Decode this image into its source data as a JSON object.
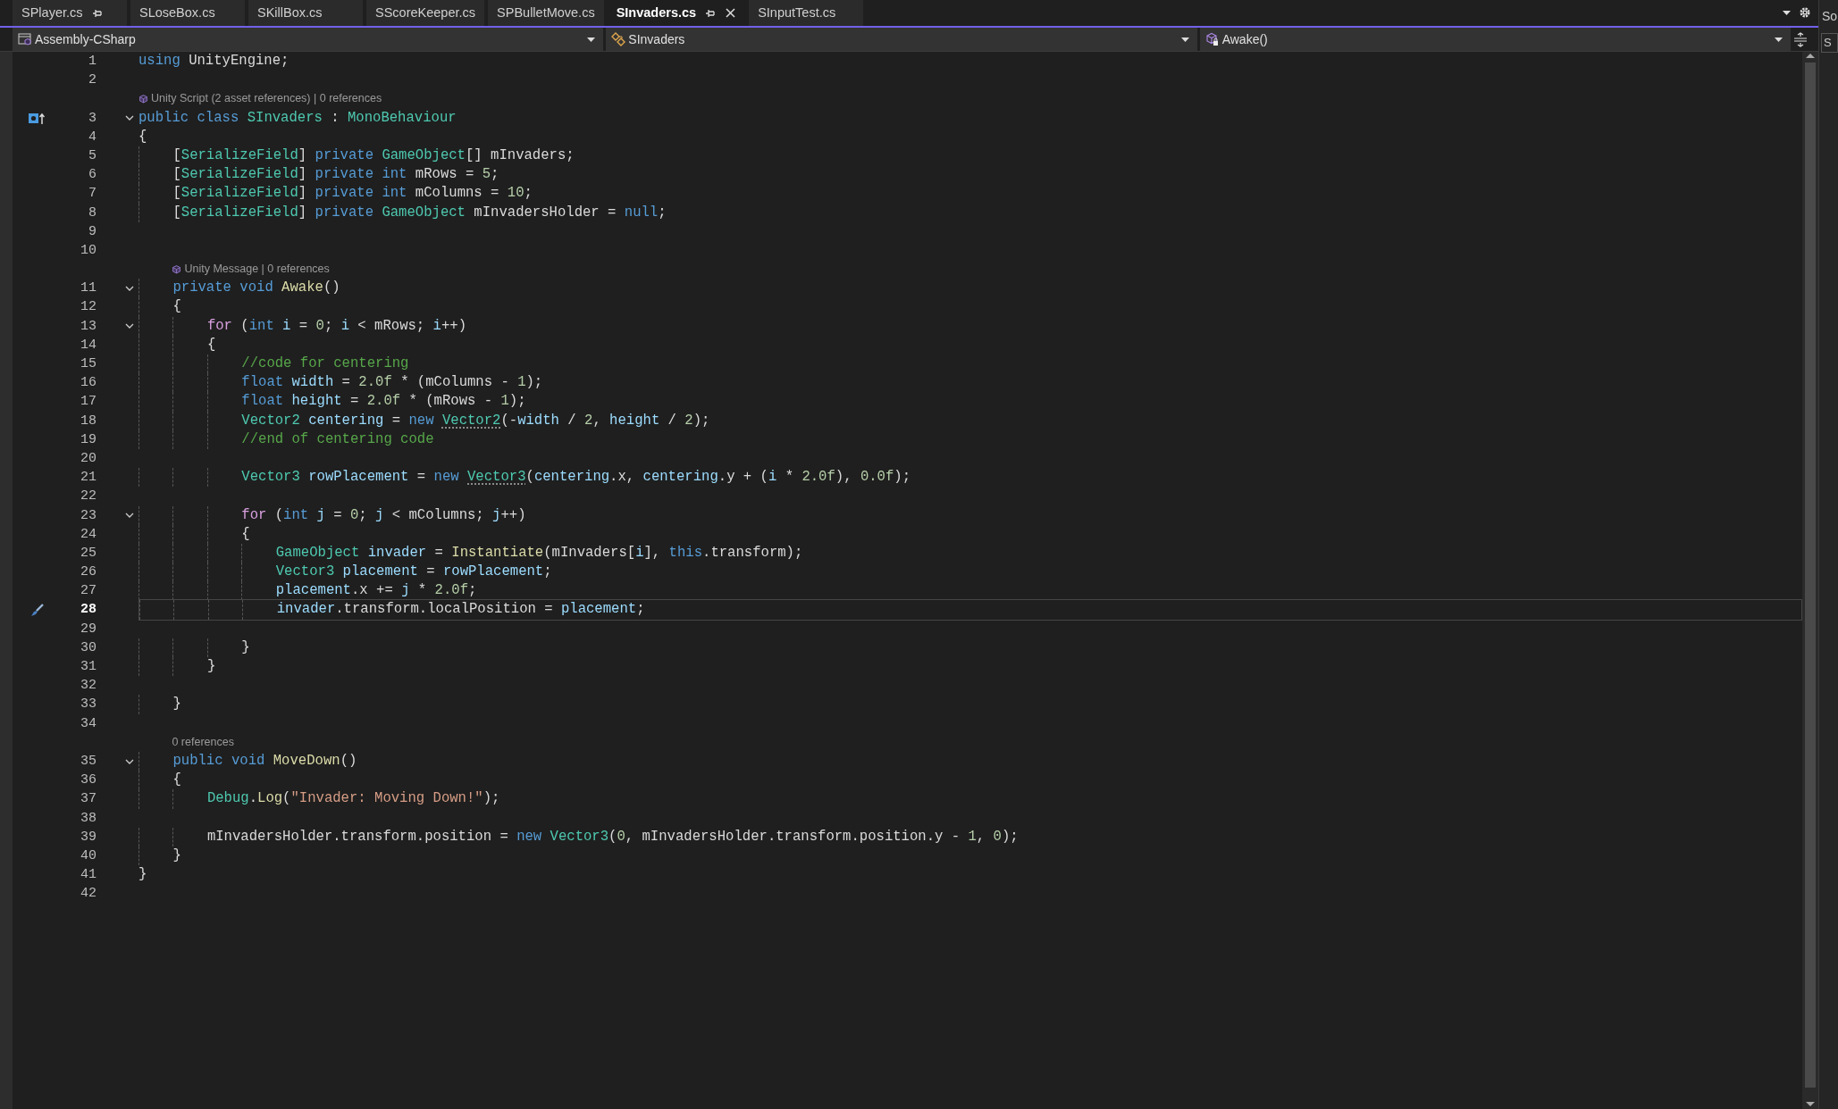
{
  "tabs": [
    {
      "label": "SPlayer.cs",
      "selected": false,
      "pinned": true
    },
    {
      "label": "SLoseBox.cs",
      "selected": false,
      "pinned": false
    },
    {
      "label": "SKillBox.cs",
      "selected": false,
      "pinned": false
    },
    {
      "label": "SScoreKeeper.cs",
      "selected": false,
      "pinned": false
    },
    {
      "label": "SPBulletMove.cs",
      "selected": false,
      "pinned": false
    },
    {
      "label": "SInvaders.cs",
      "selected": true,
      "pinned": true
    },
    {
      "label": "SInputTest.cs",
      "selected": false,
      "pinned": false
    }
  ],
  "navigation_bar": [
    {
      "label": "Assembly-CSharp",
      "kind": "project"
    },
    {
      "label": "SInvaders",
      "kind": "class"
    },
    {
      "label": "Awake()",
      "kind": "method"
    }
  ],
  "lines": [
    {
      "number": "1",
      "current": false,
      "tokens": [
        {
          "kind": "keyword",
          "text": "using"
        },
        {
          "kind": "plain",
          "text": " UnityEngine;"
        }
      ]
    },
    {
      "number": "2",
      "current": false
    },
    {
      "number": "3",
      "current": false,
      "gutter_icon": {
        "kind": "class-marker"
      },
      "expanded": true,
      "codelens": {
        "kind": "unity",
        "text": "Unity Script (2 asset references) | 0 references"
      },
      "tokens": [
        {
          "kind": "keyword",
          "text": "public"
        },
        {
          "kind": "keyword",
          "text": " class"
        },
        {
          "kind": "type",
          "text": " SInvaders"
        },
        {
          "kind": "plain",
          "text": " : "
        },
        {
          "kind": "type",
          "text": "MonoBehaviour"
        }
      ]
    },
    {
      "number": "4",
      "current": false,
      "tokens": [
        {
          "kind": "plain",
          "text": "{"
        }
      ]
    },
    {
      "number": "5",
      "current": false,
      "tokens": [
        {
          "kind": "plain",
          "text": "    ["
        },
        {
          "kind": "type",
          "text": "SerializeField"
        },
        {
          "kind": "plain",
          "text": "] "
        },
        {
          "kind": "keyword",
          "text": "private"
        },
        {
          "kind": "type",
          "text": " GameObject"
        },
        {
          "kind": "plain",
          "text": "[] mInvaders;"
        }
      ]
    },
    {
      "number": "6",
      "current": false,
      "tokens": [
        {
          "kind": "plain",
          "text": "    ["
        },
        {
          "kind": "type",
          "text": "SerializeField"
        },
        {
          "kind": "plain",
          "text": "] "
        },
        {
          "kind": "keyword",
          "text": "private"
        },
        {
          "kind": "keyword",
          "text": " int"
        },
        {
          "kind": "plain",
          "text": " mRows = "
        },
        {
          "kind": "number",
          "text": "5"
        },
        {
          "kind": "plain",
          "text": ";"
        }
      ]
    },
    {
      "number": "7",
      "current": false,
      "tokens": [
        {
          "kind": "plain",
          "text": "    ["
        },
        {
          "kind": "type",
          "text": "SerializeField"
        },
        {
          "kind": "plain",
          "text": "] "
        },
        {
          "kind": "keyword",
          "text": "private"
        },
        {
          "kind": "keyword",
          "text": " int"
        },
        {
          "kind": "plain",
          "text": " mColumns = "
        },
        {
          "kind": "number",
          "text": "10"
        },
        {
          "kind": "plain",
          "text": ";"
        }
      ]
    },
    {
      "number": "8",
      "current": false,
      "tokens": [
        {
          "kind": "plain",
          "text": "    ["
        },
        {
          "kind": "type",
          "text": "SerializeField"
        },
        {
          "kind": "plain",
          "text": "] "
        },
        {
          "kind": "keyword",
          "text": "private"
        },
        {
          "kind": "type",
          "text": " GameObject"
        },
        {
          "kind": "plain",
          "text": " mInvadersHolder = "
        },
        {
          "kind": "keyword",
          "text": "null"
        },
        {
          "kind": "plain",
          "text": ";"
        }
      ]
    },
    {
      "number": "9",
      "current": false
    },
    {
      "number": "10",
      "current": false
    },
    {
      "number": "11",
      "current": false,
      "expanded": true,
      "codelens": {
        "kind": "unity",
        "text": "Unity Message | 0 references"
      },
      "tokens": [
        {
          "kind": "keyword",
          "text": "    private"
        },
        {
          "kind": "keyword",
          "text": " void"
        },
        {
          "kind": "method",
          "text": " Awake"
        },
        {
          "kind": "plain",
          "text": "()"
        }
      ]
    },
    {
      "number": "12",
      "current": false,
      "tokens": [
        {
          "kind": "plain",
          "text": "    {"
        }
      ]
    },
    {
      "number": "13",
      "current": false,
      "expanded": true,
      "tokens": [
        {
          "kind": "control",
          "text": "        for"
        },
        {
          "kind": "plain",
          "text": " ("
        },
        {
          "kind": "keyword",
          "text": "int"
        },
        {
          "kind": "variable",
          "text": " i"
        },
        {
          "kind": "plain",
          "text": " = "
        },
        {
          "kind": "number",
          "text": "0"
        },
        {
          "kind": "plain",
          "text": "; "
        },
        {
          "kind": "variable",
          "text": "i"
        },
        {
          "kind": "plain",
          "text": " < mRows; "
        },
        {
          "kind": "variable",
          "text": "i"
        },
        {
          "kind": "plain",
          "text": "++)"
        }
      ]
    },
    {
      "number": "14",
      "current": false,
      "tokens": [
        {
          "kind": "plain",
          "text": "        {"
        }
      ]
    },
    {
      "number": "15",
      "current": false,
      "tokens": [
        {
          "kind": "comment",
          "text": "            //code for centering"
        }
      ]
    },
    {
      "number": "16",
      "current": false,
      "tokens": [
        {
          "kind": "keyword",
          "text": "            float"
        },
        {
          "kind": "variable",
          "text": " width"
        },
        {
          "kind": "plain",
          "text": " = "
        },
        {
          "kind": "number",
          "text": "2.0f"
        },
        {
          "kind": "plain",
          "text": " * (mColumns - "
        },
        {
          "kind": "number",
          "text": "1"
        },
        {
          "kind": "plain",
          "text": ");"
        }
      ]
    },
    {
      "number": "17",
      "current": false,
      "tokens": [
        {
          "kind": "keyword",
          "text": "            float"
        },
        {
          "kind": "variable",
          "text": " height"
        },
        {
          "kind": "plain",
          "text": " = "
        },
        {
          "kind": "number",
          "text": "2.0f"
        },
        {
          "kind": "plain",
          "text": " * (mRows - "
        },
        {
          "kind": "number",
          "text": "1"
        },
        {
          "kind": "plain",
          "text": ");"
        }
      ]
    },
    {
      "number": "18",
      "current": false,
      "tokens": [
        {
          "kind": "type",
          "text": "            Vector2"
        },
        {
          "kind": "variable",
          "text": " centering"
        },
        {
          "kind": "plain",
          "text": " = "
        },
        {
          "kind": "keyword",
          "text": "new "
        },
        {
          "kind": "type",
          "text": "Vector2",
          "hint": true
        },
        {
          "kind": "plain",
          "text": "(-"
        },
        {
          "kind": "variable",
          "text": "width"
        },
        {
          "kind": "plain",
          "text": " / "
        },
        {
          "kind": "number",
          "text": "2"
        },
        {
          "kind": "plain",
          "text": ", "
        },
        {
          "kind": "variable",
          "text": "height"
        },
        {
          "kind": "plain",
          "text": " / "
        },
        {
          "kind": "number",
          "text": "2"
        },
        {
          "kind": "plain",
          "text": ");"
        }
      ]
    },
    {
      "number": "19",
      "current": false,
      "tokens": [
        {
          "kind": "comment",
          "text": "            //end of centering code"
        }
      ]
    },
    {
      "number": "20",
      "current": false
    },
    {
      "number": "21",
      "current": false,
      "tokens": [
        {
          "kind": "type",
          "text": "            Vector3"
        },
        {
          "kind": "variable",
          "text": " rowPlacement"
        },
        {
          "kind": "plain",
          "text": " = "
        },
        {
          "kind": "keyword",
          "text": "new "
        },
        {
          "kind": "type",
          "text": "Vector3",
          "hint": true
        },
        {
          "kind": "plain",
          "text": "("
        },
        {
          "kind": "variable",
          "text": "centering"
        },
        {
          "kind": "plain",
          "text": ".x, "
        },
        {
          "kind": "variable",
          "text": "centering"
        },
        {
          "kind": "plain",
          "text": ".y + ("
        },
        {
          "kind": "variable",
          "text": "i"
        },
        {
          "kind": "plain",
          "text": " * "
        },
        {
          "kind": "number",
          "text": "2.0f"
        },
        {
          "kind": "plain",
          "text": "), "
        },
        {
          "kind": "number",
          "text": "0.0f"
        },
        {
          "kind": "plain",
          "text": ");"
        }
      ]
    },
    {
      "number": "22",
      "current": false
    },
    {
      "number": "23",
      "current": false,
      "expanded": true,
      "tokens": [
        {
          "kind": "control",
          "text": "            for"
        },
        {
          "kind": "plain",
          "text": " ("
        },
        {
          "kind": "keyword",
          "text": "int"
        },
        {
          "kind": "variable",
          "text": " j"
        },
        {
          "kind": "plain",
          "text": " = "
        },
        {
          "kind": "number",
          "text": "0"
        },
        {
          "kind": "plain",
          "text": "; "
        },
        {
          "kind": "variable",
          "text": "j"
        },
        {
          "kind": "plain",
          "text": " < mColumns; "
        },
        {
          "kind": "variable",
          "text": "j"
        },
        {
          "kind": "plain",
          "text": "++)"
        }
      ]
    },
    {
      "number": "24",
      "current": false,
      "tokens": [
        {
          "kind": "plain",
          "text": "            {"
        }
      ]
    },
    {
      "number": "25",
      "current": false,
      "tokens": [
        {
          "kind": "type",
          "text": "                GameObject"
        },
        {
          "kind": "variable",
          "text": " invader"
        },
        {
          "kind": "plain",
          "text": " = "
        },
        {
          "kind": "method",
          "text": "Instantiate"
        },
        {
          "kind": "plain",
          "text": "(mInvaders["
        },
        {
          "kind": "variable",
          "text": "i"
        },
        {
          "kind": "plain",
          "text": "], "
        },
        {
          "kind": "keyword",
          "text": "this"
        },
        {
          "kind": "plain",
          "text": ".transform);"
        }
      ]
    },
    {
      "number": "26",
      "current": false,
      "tokens": [
        {
          "kind": "type",
          "text": "                Vector3"
        },
        {
          "kind": "variable",
          "text": " placement"
        },
        {
          "kind": "plain",
          "text": " = "
        },
        {
          "kind": "variable",
          "text": "rowPlacement"
        },
        {
          "kind": "plain",
          "text": ";"
        }
      ]
    },
    {
      "number": "27",
      "current": false,
      "tokens": [
        {
          "kind": "variable",
          "text": "                placement"
        },
        {
          "kind": "plain",
          "text": ".x += "
        },
        {
          "kind": "variable",
          "text": "j"
        },
        {
          "kind": "plain",
          "text": " * "
        },
        {
          "kind": "number",
          "text": "2.0f"
        },
        {
          "kind": "plain",
          "text": ";"
        }
      ]
    },
    {
      "number": "28",
      "current": true,
      "gutter_icon": {
        "kind": "edit"
      },
      "tokens": [
        {
          "kind": "variable",
          "text": "                invader"
        },
        {
          "kind": "plain",
          "text": ".transform.localPosition = "
        },
        {
          "kind": "variable",
          "text": "placement"
        },
        {
          "kind": "plain",
          "text": ";"
        }
      ]
    },
    {
      "number": "29",
      "current": false
    },
    {
      "number": "30",
      "current": false,
      "tokens": [
        {
          "kind": "plain",
          "text": "            }"
        }
      ]
    },
    {
      "number": "31",
      "current": false,
      "tokens": [
        {
          "kind": "plain",
          "text": "        }"
        }
      ]
    },
    {
      "number": "32",
      "current": false
    },
    {
      "number": "33",
      "current": false,
      "tokens": [
        {
          "kind": "plain",
          "text": "    }"
        }
      ]
    },
    {
      "number": "34",
      "current": false
    },
    {
      "number": "35",
      "current": false,
      "expanded": true,
      "codelens": {
        "kind": "plain",
        "text": "0 references"
      },
      "tokens": [
        {
          "kind": "keyword",
          "text": "    public"
        },
        {
          "kind": "keyword",
          "text": " void"
        },
        {
          "kind": "method",
          "text": " MoveDown"
        },
        {
          "kind": "plain",
          "text": "()"
        }
      ]
    },
    {
      "number": "36",
      "current": false,
      "tokens": [
        {
          "kind": "plain",
          "text": "    {"
        }
      ]
    },
    {
      "number": "37",
      "current": false,
      "tokens": [
        {
          "kind": "type",
          "text": "        Debug"
        },
        {
          "kind": "plain",
          "text": "."
        },
        {
          "kind": "method",
          "text": "Log"
        },
        {
          "kind": "plain",
          "text": "("
        },
        {
          "kind": "string",
          "text": "\"Invader: Moving Down!\""
        },
        {
          "kind": "plain",
          "text": ");"
        }
      ]
    },
    {
      "number": "38",
      "current": false
    },
    {
      "number": "39",
      "current": false,
      "tokens": [
        {
          "kind": "plain",
          "text": "        mInvadersHolder.transform.position = "
        },
        {
          "kind": "keyword",
          "text": "new"
        },
        {
          "kind": "type",
          "text": " Vector3"
        },
        {
          "kind": "plain",
          "text": "("
        },
        {
          "kind": "number",
          "text": "0"
        },
        {
          "kind": "plain",
          "text": ", mInvadersHolder.transform.position.y - "
        },
        {
          "kind": "number",
          "text": "1"
        },
        {
          "kind": "plain",
          "text": ", "
        },
        {
          "kind": "number",
          "text": "0"
        },
        {
          "kind": "plain",
          "text": ");"
        }
      ]
    },
    {
      "number": "40",
      "current": false,
      "tokens": [
        {
          "kind": "plain",
          "text": "    }"
        }
      ]
    },
    {
      "number": "41",
      "current": false,
      "tokens": [
        {
          "kind": "plain",
          "text": "}"
        }
      ]
    },
    {
      "number": "42",
      "current": false
    }
  ],
  "side_panel": {
    "title": "So",
    "field": "S"
  }
}
